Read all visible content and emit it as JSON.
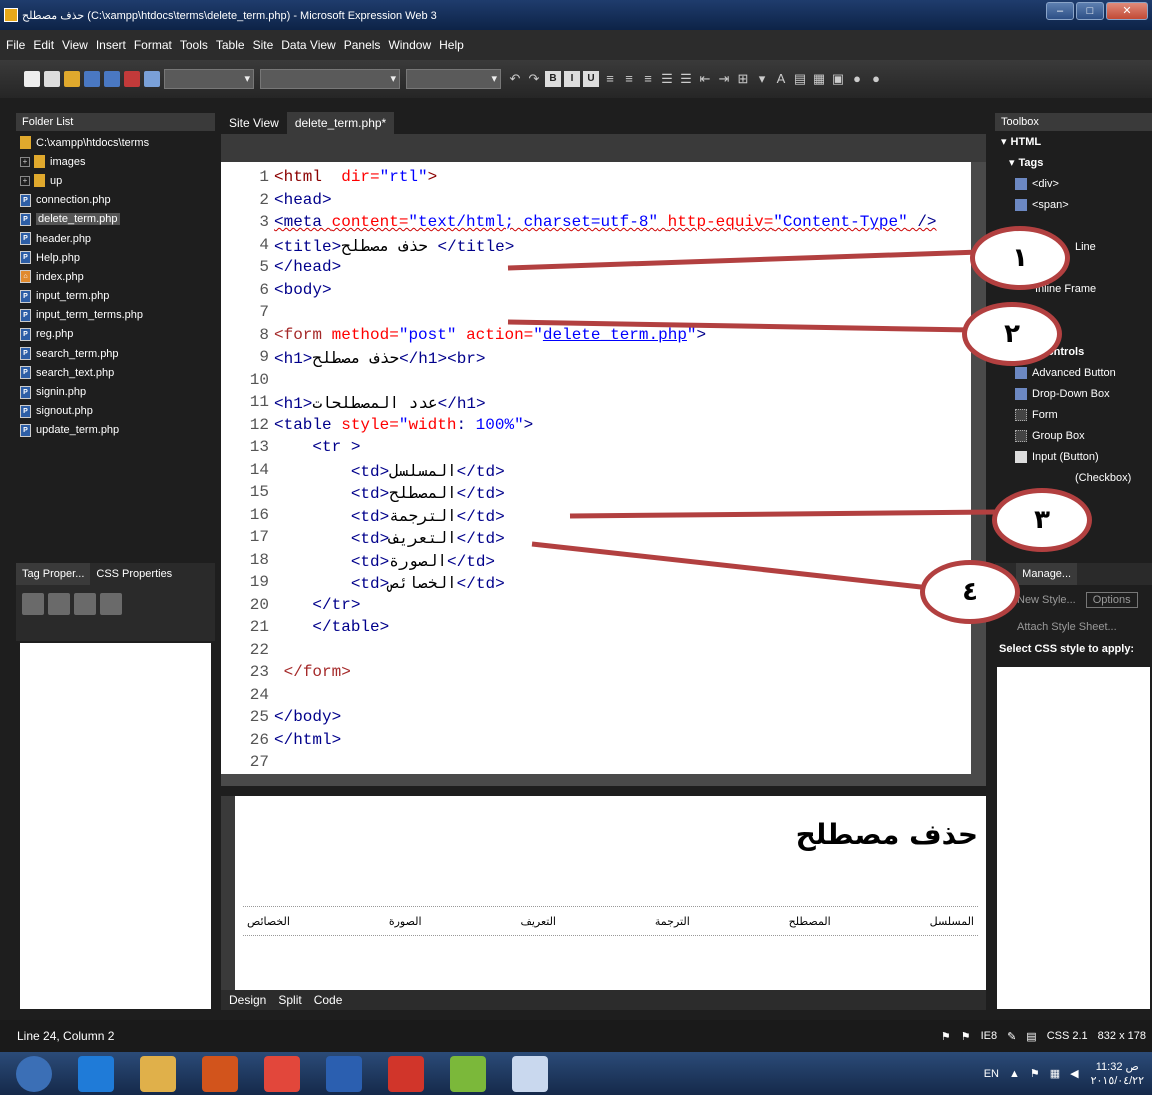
{
  "window": {
    "title": "حذف مصطلح (C:\\xampp\\htdocs\\terms\\delete_term.php) - Microsoft Expression Web 3"
  },
  "menu": [
    "File",
    "Edit",
    "View",
    "Insert",
    "Format",
    "Tools",
    "Table",
    "Site",
    "Data View",
    "Panels",
    "Window",
    "Help"
  ],
  "folder_list": {
    "title": "Folder List",
    "root": "C:\\xampp\\htdocs\\terms",
    "items": [
      {
        "label": "images",
        "type": "folder"
      },
      {
        "label": "up",
        "type": "folder"
      },
      {
        "label": "connection.php",
        "type": "file"
      },
      {
        "label": "delete_term.php",
        "type": "file",
        "selected": true
      },
      {
        "label": "header.php",
        "type": "file"
      },
      {
        "label": "Help.php",
        "type": "file"
      },
      {
        "label": "index.php",
        "type": "file"
      },
      {
        "label": "input_term.php",
        "type": "file"
      },
      {
        "label": "input_term_terms.php",
        "type": "file"
      },
      {
        "label": "reg.php",
        "type": "file"
      },
      {
        "label": "search_term.php",
        "type": "file"
      },
      {
        "label": "search_text.php",
        "type": "file"
      },
      {
        "label": "signin.php",
        "type": "file"
      },
      {
        "label": "signout.php",
        "type": "file"
      },
      {
        "label": "update_term.php",
        "type": "file"
      }
    ]
  },
  "tag_panel": {
    "tabs": [
      "Tag Proper...",
      "CSS Properties"
    ]
  },
  "editor": {
    "tabs": [
      "Site View",
      "delete_term.php*"
    ],
    "lines": [
      "<html  dir=\"rtl\">",
      "<head>",
      "<meta content=\"text/html; charset=utf-8\" http-equiv=\"Content-Type\" />",
      "<title>حذف مصطلح </title>",
      "</head>",
      "<body>",
      "",
      "<form method=\"post\" action=\"delete_term.php\">",
      "<h1>حذف مصطلح</h1><br>",
      "",
      "<h1>عدد المصطلحات</h1>",
      "<table style=\"width: 100%\">",
      "    <tr >",
      "        <td>المسلسل</td>",
      "        <td>المصطلح</td>",
      "        <td>الترجمة</td>",
      "        <td>التعريف</td>",
      "        <td>الصورة</td>",
      "        <td>الخصائص</td>",
      "    </tr>",
      "    </table>",
      "",
      " </form>",
      "",
      "</body>",
      "</html>",
      ""
    ]
  },
  "design": {
    "heading": "حذف مصطلح",
    "columns": [
      "المسلسل",
      "المصطلح",
      "الترجمة",
      "التعريف",
      "الصورة",
      "الخصائص"
    ],
    "view_tabs": [
      "Design",
      "Split",
      "Code"
    ]
  },
  "toolbox": {
    "title": "Toolbox",
    "items": [
      "HTML",
      "Tags",
      "<div>",
      "<span>",
      "",
      "Line",
      "Inline Frame",
      "",
      "",
      "Controls",
      "Advanced Button",
      "Drop-Down Box",
      "Form",
      "Group Box",
      "Input (Button)",
      "(Checkbox)"
    ]
  },
  "styles_panel": {
    "tabs": [
      "...",
      "Manage..."
    ],
    "new_style": "New Style...",
    "options": "Options",
    "attach": "Attach Style Sheet...",
    "select_label": "Select CSS style to apply:"
  },
  "status": {
    "position": "Line 24, Column 2",
    "browser": "IE8",
    "css": "CSS 2.1",
    "size": "832 x 178"
  },
  "taskbar": {
    "lang": "EN",
    "time": "11:32 ص",
    "date": "٢٠١٥/٠٤/٢٢"
  },
  "annotations": [
    "١",
    "٢",
    "٣",
    "٤"
  ]
}
